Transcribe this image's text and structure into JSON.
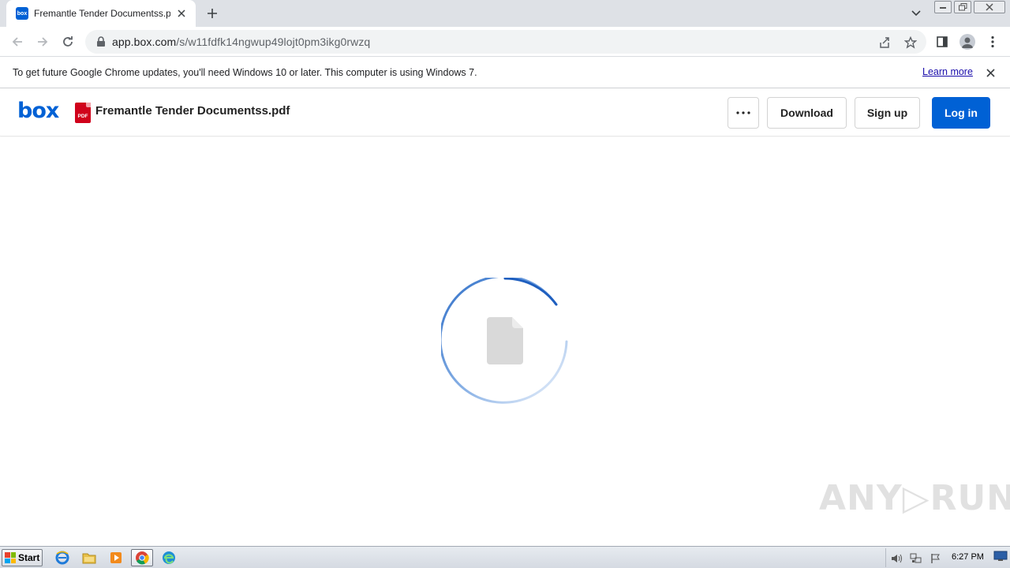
{
  "browser": {
    "tab": {
      "title": "Fremantle Tender Documentss.pdf | Powered by Box",
      "favicon_text": "box"
    },
    "url": {
      "host": "app.box.com",
      "path": "/s/w11fdfk14ngwup49lojt0pm3ikg0rwzq"
    },
    "infobar": {
      "message": "To get future Google Chrome updates, you'll need Windows 10 or later. This computer is using Windows 7.",
      "link": "Learn more"
    }
  },
  "box": {
    "logo": "box",
    "file_type_badge": "PDF",
    "file_name": "Fremantle Tender Documentss.pdf",
    "more_label": "···",
    "download_label": "Download",
    "signup_label": "Sign up",
    "login_label": "Log in",
    "brand_color": "#0061d5"
  },
  "viewer": {
    "state": "loading",
    "icon": "document-icon"
  },
  "watermark": "ANY▷RUN",
  "taskbar": {
    "start_label": "Start",
    "apps": [
      "internet-explorer-icon",
      "file-explorer-icon",
      "media-player-icon",
      "chrome-icon",
      "edge-icon"
    ],
    "clock": "6:27 PM"
  }
}
